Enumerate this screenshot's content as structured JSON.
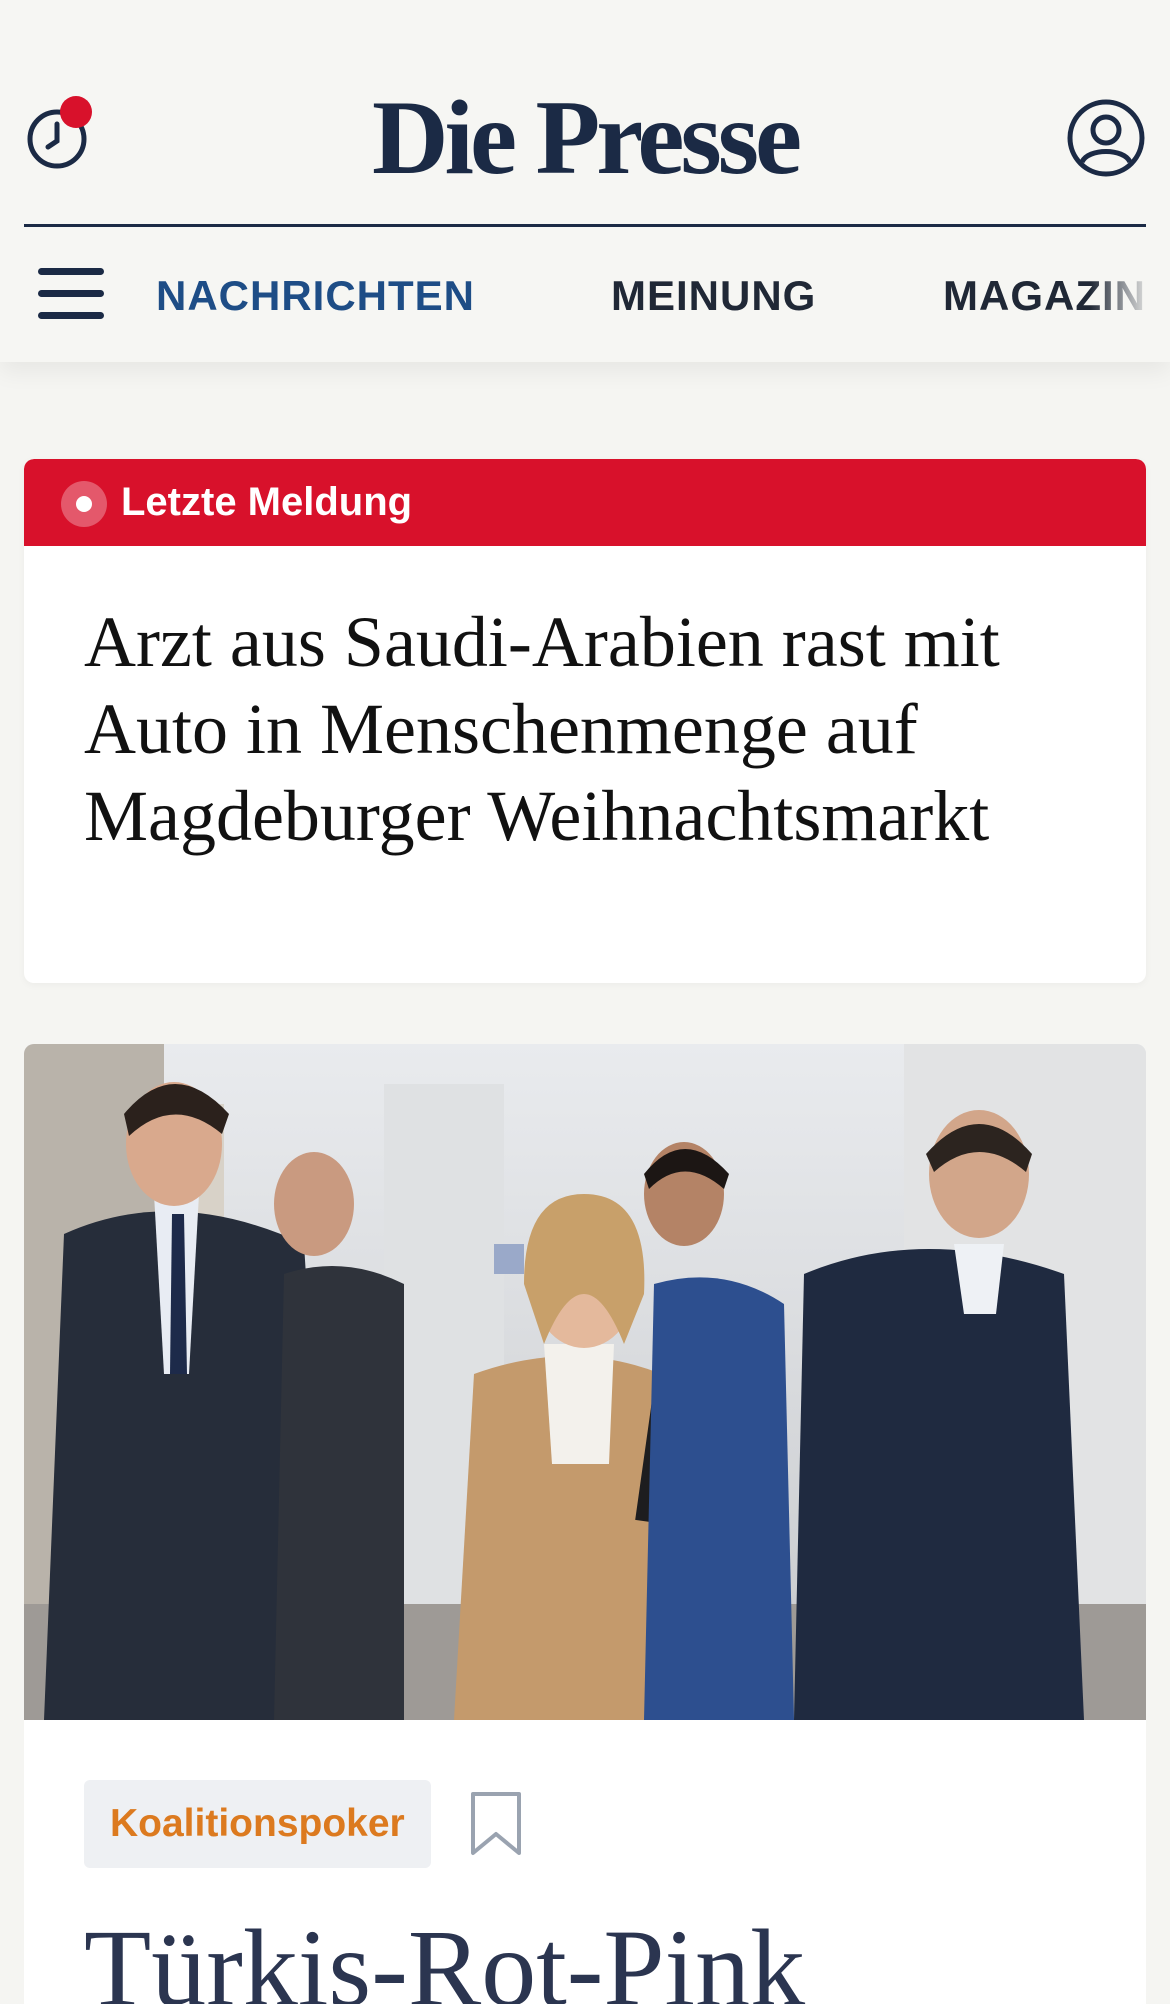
{
  "header": {
    "logo": "Die Presse",
    "history_icon": "clock-history-icon",
    "account_icon": "user-account-icon",
    "menu_icon": "hamburger-menu-icon",
    "notification_color": "#d8112b"
  },
  "nav": {
    "items": [
      {
        "label": "NACHRICHTEN",
        "active": true
      },
      {
        "label": "MEINUNG",
        "active": false
      },
      {
        "label": "MAGAZIN",
        "active": false
      }
    ]
  },
  "breaking": {
    "label": "Letzte Meldung",
    "headline": "Arzt aus Saudi-Arabien rast mit Auto in Menschenmenge auf Magdeburger Weihnachtsmarkt",
    "color": "#d8112b"
  },
  "story": {
    "tag": "Koalitionspoker",
    "tag_color": "#dc7a1f",
    "bookmark_icon": "bookmark-icon",
    "headline": "Türkis-Rot-Pink",
    "image_alt": "Group of politicians walking on a street"
  },
  "colors": {
    "brand": "#1b2a45",
    "nav_active": "#1e4d86",
    "background": "#f5f5f2"
  }
}
